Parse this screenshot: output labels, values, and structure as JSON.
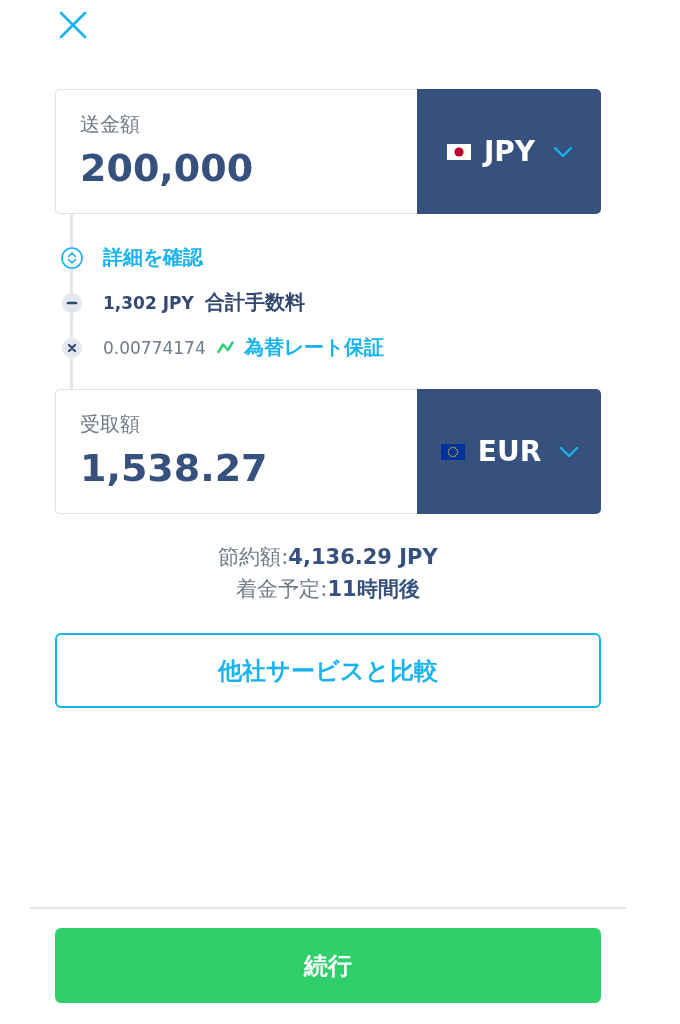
{
  "send": {
    "label": "送金額",
    "value": "200,000",
    "currency": "JPY"
  },
  "details": [
    {
      "kind": "toggle",
      "label": "詳細を確認"
    },
    {
      "kind": "fee",
      "amount": "1,302 JPY",
      "label": "合計手数料"
    },
    {
      "kind": "rate",
      "rate": "0.00774174",
      "label": "為替レート保証"
    }
  ],
  "receive": {
    "label": "受取額",
    "value": "1,538.27",
    "currency": "EUR"
  },
  "summary": [
    "節約額:**4,136.29 JPY**",
    "着金予定:**11時間後**"
  ],
  "compare_button": "他社サービスと比較",
  "continue_button": "続行"
}
